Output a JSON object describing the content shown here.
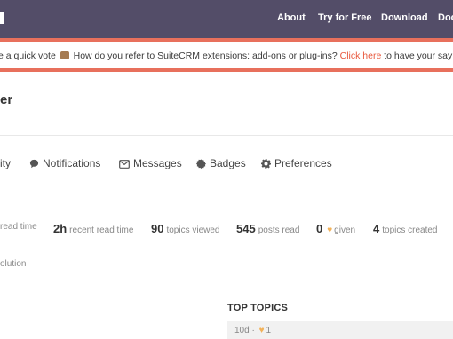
{
  "header": {
    "nav": [
      "About",
      "Try for Free",
      "Download",
      "Doc"
    ]
  },
  "banner": {
    "prefix": "e a quick vote",
    "question": " How do you refer to SuiteCRM extensions: add-ons or plug-ins? ",
    "link": "Click here",
    "suffix": " to have your say"
  },
  "page": {
    "title_fragment": "er"
  },
  "tabs": [
    {
      "label": "ity",
      "icon": "activity-icon"
    },
    {
      "label": "Notifications",
      "icon": "comment-icon"
    },
    {
      "label": "Messages",
      "icon": "envelope-icon"
    },
    {
      "label": "Badges",
      "icon": "certificate-icon"
    },
    {
      "label": "Preferences",
      "icon": "gear-icon"
    }
  ],
  "stats": [
    {
      "value": "",
      "label": "read time"
    },
    {
      "value": "2h",
      "label": "recent read time"
    },
    {
      "value": "90",
      "label": "topics viewed"
    },
    {
      "value": "545",
      "label": "posts read"
    },
    {
      "value": "0",
      "label": "given"
    },
    {
      "value": "4",
      "label": "topics created"
    }
  ],
  "solution_fragment": "olution",
  "top_topics": {
    "heading": "TOP TOPICS",
    "first_meta_age": "10d",
    "first_meta_likes": "1"
  },
  "colors": {
    "header_bg": "#534d68",
    "banner_border": "#e8705c",
    "link": "#e8593e",
    "heart": "#f2b25a"
  }
}
